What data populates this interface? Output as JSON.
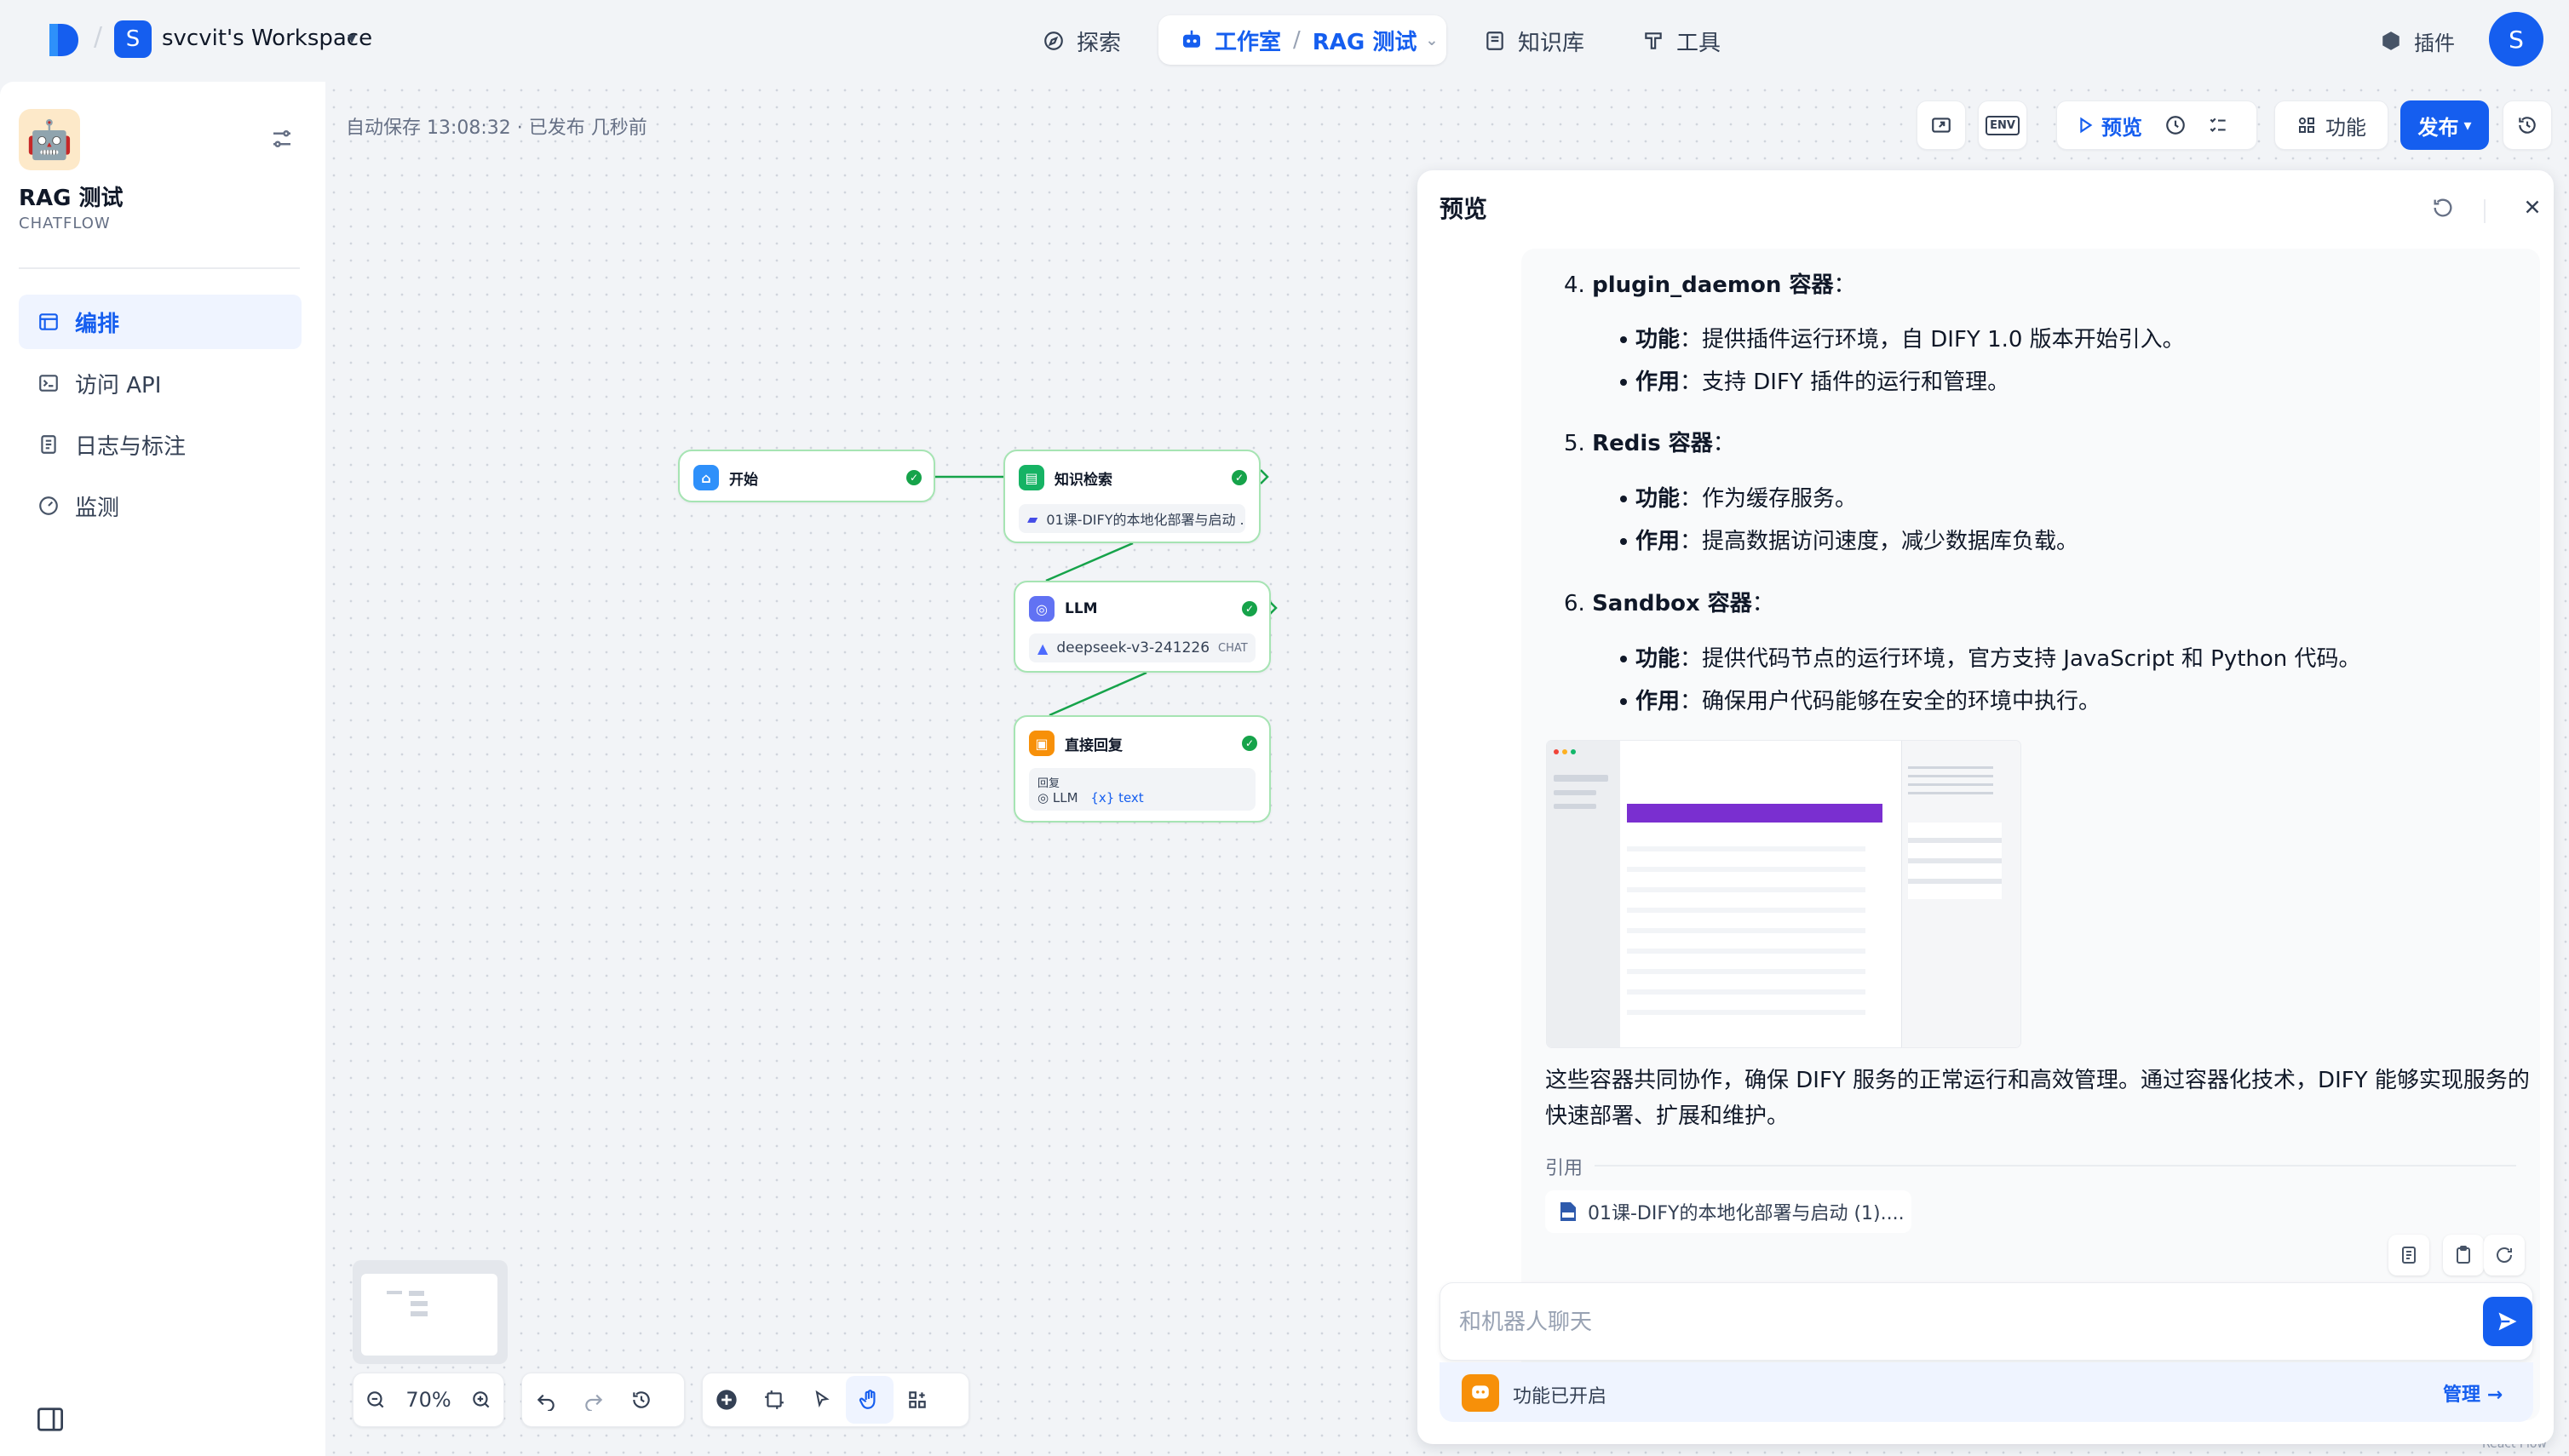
{
  "topbar": {
    "workspace_initial": "S",
    "workspace_name": "svcvit's Workspace",
    "nav_explore": "探索",
    "nav_studio": "工作室",
    "nav_app": "RAG 测试",
    "nav_knowledge": "知识库",
    "nav_tools": "工具",
    "plugins": "插件",
    "user_initial": "S"
  },
  "sidebar": {
    "app_name": "RAG 测试",
    "app_type": "CHATFLOW",
    "items": [
      {
        "label": "编排",
        "icon": "layout-icon",
        "active": true
      },
      {
        "label": "访问 API",
        "icon": "terminal-icon",
        "active": false
      },
      {
        "label": "日志与标注",
        "icon": "file-list-icon",
        "active": false
      },
      {
        "label": "监测",
        "icon": "dashboard-icon",
        "active": false
      }
    ]
  },
  "canvas": {
    "autosave": "自动保存 13:08:32 · 已发布 几秒前",
    "toolbar": {
      "env": "ENV",
      "preview": "预览",
      "features": "功能",
      "publish": "发布"
    },
    "zoom": "70%",
    "nodes": {
      "start": {
        "title": "开始"
      },
      "retrieval": {
        "title": "知识检索",
        "dataset": "01课-DIFY的本地化部署与启动 ..."
      },
      "llm": {
        "title": "LLM",
        "model": "deepseek-v3-241226",
        "mode": "CHAT"
      },
      "answer": {
        "title": "直接回复",
        "label": "回复",
        "var_node": "LLM",
        "var_name": "text"
      }
    },
    "watermark": "React Flow"
  },
  "preview": {
    "title": "预览",
    "sections": [
      {
        "heading_num": "4.",
        "heading": "plugin_daemon 容器",
        "bullets": [
          {
            "key": "功能",
            "text": "：提供插件运行环境，自 DIFY 1.0 版本开始引入。"
          },
          {
            "key": "作用",
            "text": "：支持 DIFY 插件的运行和管理。"
          }
        ]
      },
      {
        "heading_num": "5.",
        "heading": "Redis 容器",
        "bullets": [
          {
            "key": "功能",
            "text": "：作为缓存服务。"
          },
          {
            "key": "作用",
            "text": "：提高数据访问速度，减少数据库负载。"
          }
        ]
      },
      {
        "heading_num": "6.",
        "heading": "Sandbox 容器",
        "bullets": [
          {
            "key": "功能",
            "text": "：提供代码节点的运行环境，官方支持 JavaScript 和 Python 代码。"
          },
          {
            "key": "作用",
            "text": "：确保用户代码能够在安全的环境中执行。"
          }
        ]
      }
    ],
    "colon": "：",
    "summary": "这些容器共同协作，确保 DIFY 服务的正常运行和高效管理。通过容器化技术，DIFY 能够实现服务的快速部署、扩展和维护。",
    "citation_label": "引用",
    "citation": "01课-DIFY的本地化部署与启动 (1)....",
    "input_placeholder": "和机器人聊天",
    "feature_status": "功能已开启",
    "manage": "管理"
  },
  "colors": {
    "accent": "#155eef",
    "node_border": "#a6e4b3",
    "success": "#16a34a"
  }
}
